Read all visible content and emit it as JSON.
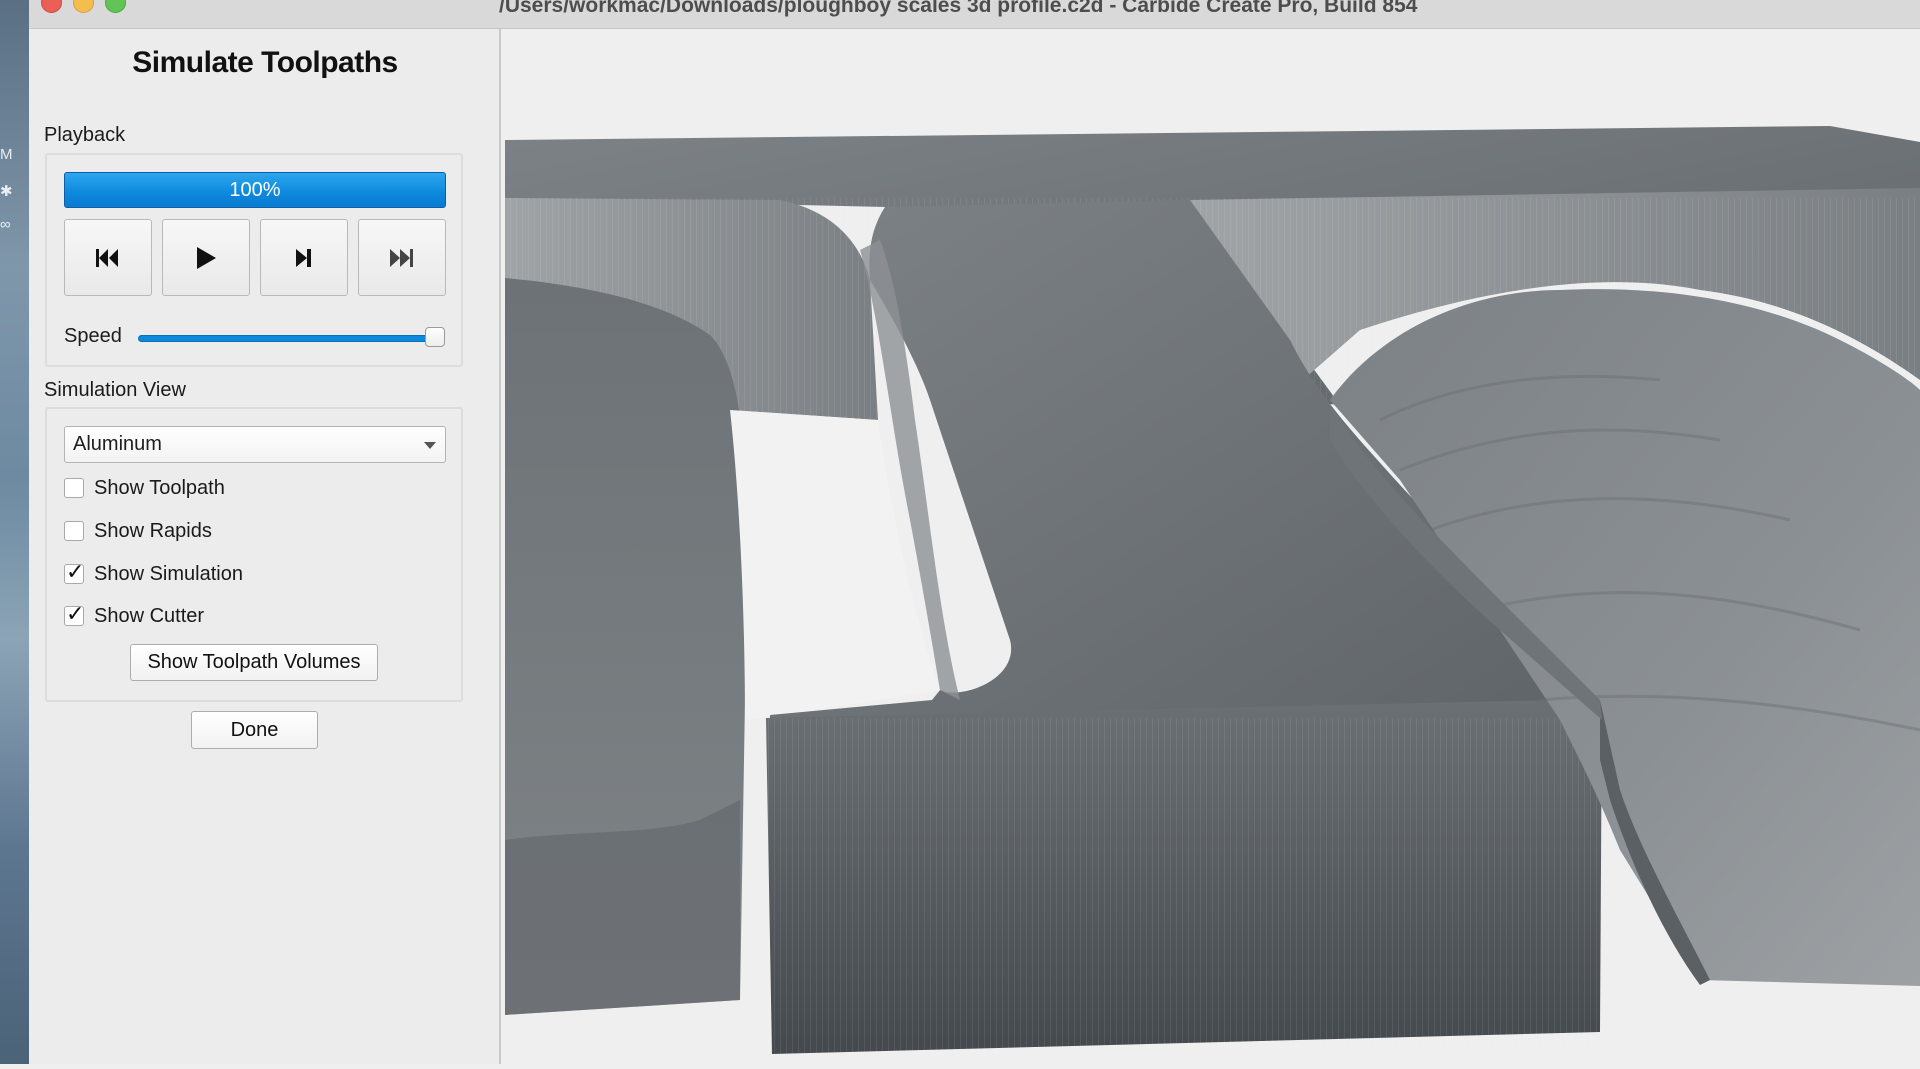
{
  "window": {
    "title": "/Users/workmac/Downloads/ploughboy scales 3d profile.c2d - Carbide Create Pro, Build 854"
  },
  "desktop": {
    "glyphs": [
      "M",
      "✱",
      "∞"
    ]
  },
  "panel": {
    "title": "Simulate Toolpaths",
    "playback": {
      "label": "Playback",
      "progress": {
        "value": 100,
        "text": "100%"
      },
      "buttons": [
        "skip-to-start",
        "play",
        "step-forward",
        "skip-to-end"
      ],
      "speed_label": "Speed",
      "speed_value": 1.0
    },
    "simulation_view": {
      "label": "Simulation View",
      "material": {
        "selected": "Aluminum"
      },
      "options": [
        {
          "label": "Show Toolpath",
          "checked": false
        },
        {
          "label": "Show Rapids",
          "checked": false
        },
        {
          "label": "Show Simulation",
          "checked": true
        },
        {
          "label": "Show Cutter",
          "checked": true
        }
      ],
      "volumes_button": "Show Toolpath Volumes"
    },
    "done_button": "Done"
  },
  "colors": {
    "accent": "#0c88dc",
    "metal_light": "#8e9295",
    "metal_dark": "#4f5458"
  }
}
